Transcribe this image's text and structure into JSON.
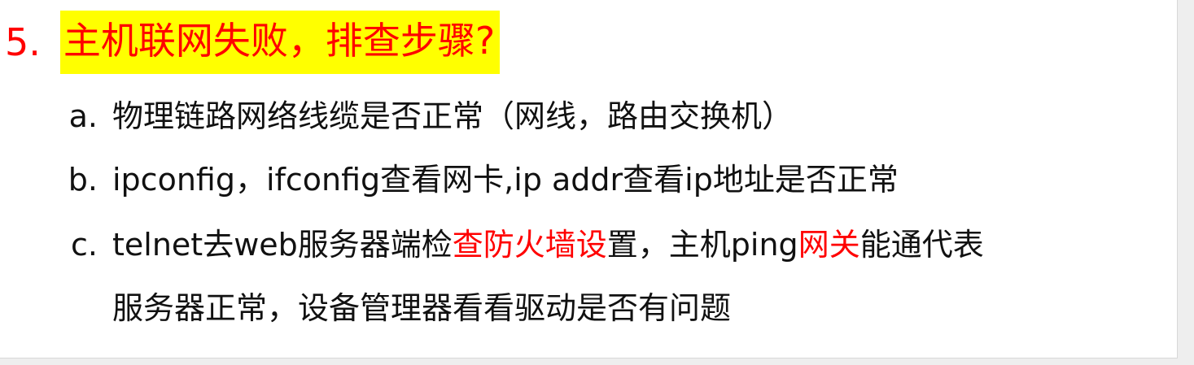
{
  "heading": {
    "number": "5.",
    "text": "主机联网失败，排查步骤?"
  },
  "items": [
    {
      "marker": "a.",
      "text": "物理链路网络线缆是否正常（网线，路由交换机）"
    },
    {
      "marker": "b.",
      "text": "ipconfig，ifconfig查看网卡,ip addr查看ip地址是否正常"
    },
    {
      "marker": "c.",
      "segments": [
        "telnet去web服务器端检",
        "查防火墙设",
        "置，主机ping",
        "网关",
        "能通代表"
      ],
      "continuation": "服务器正常，设备管理器看看驱动是否有问题"
    }
  ],
  "colors": {
    "heading_text": "#ff0000",
    "heading_highlight": "#ffff00",
    "emphasis": "#ff0000",
    "body_text": "#111111"
  }
}
